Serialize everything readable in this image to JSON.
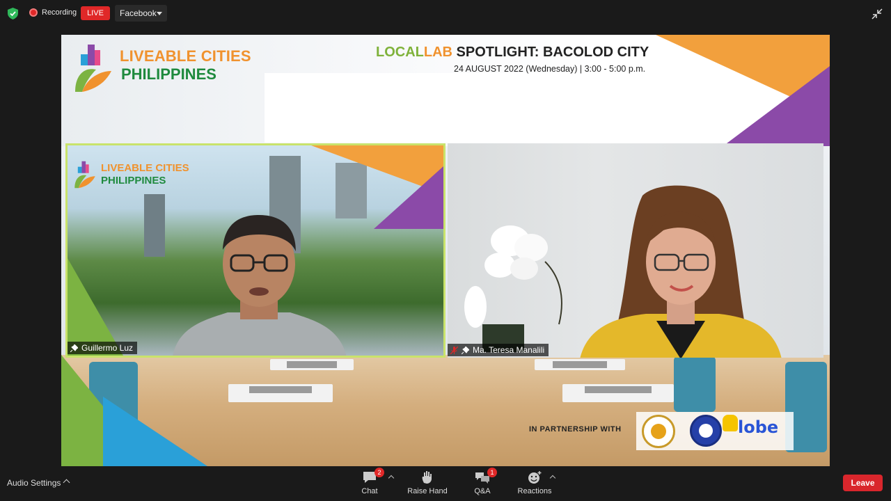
{
  "topbar": {
    "recording_label": "Recording",
    "live_label": "LIVE",
    "stream_target": "Facebook"
  },
  "slide": {
    "org_line1": "LIVEABLE CITIES",
    "org_line2": "PHILIPPINES",
    "event_title_part1": "LOCAL",
    "event_title_part2": "LAB",
    "event_title_rest": " SPOTLIGHT: BACOLOD CITY",
    "event_date": "24 AUGUST 2022 (Wednesday) | 3:00 - 5:00 p.m.",
    "partnership_label": "IN PARTNERSHIP WITH",
    "partner_logo_text": "lobe"
  },
  "participants": [
    {
      "name": "Guillermo Luz",
      "active_speaker": true,
      "muted": false,
      "pinned": true,
      "bg_line1": "LIVEABLE CITIES",
      "bg_line2": "PHILIPPINES"
    },
    {
      "name": "Ma. Teresa Manalili",
      "active_speaker": false,
      "muted": true,
      "pinned": true
    }
  ],
  "toolbar": {
    "audio_settings": "Audio Settings",
    "chat_label": "Chat",
    "chat_badge": "2",
    "raise_hand_label": "Raise Hand",
    "qa_label": "Q&A",
    "qa_badge": "1",
    "reactions_label": "Reactions",
    "leave_label": "Leave"
  },
  "colors": {
    "live_red": "#e02828",
    "active_speaker_border": "#c9e36b",
    "leave_red": "#d9262c",
    "brand_orange": "#f0922e",
    "brand_green": "#1f8a3e",
    "brand_purple": "#8b4aa8"
  }
}
